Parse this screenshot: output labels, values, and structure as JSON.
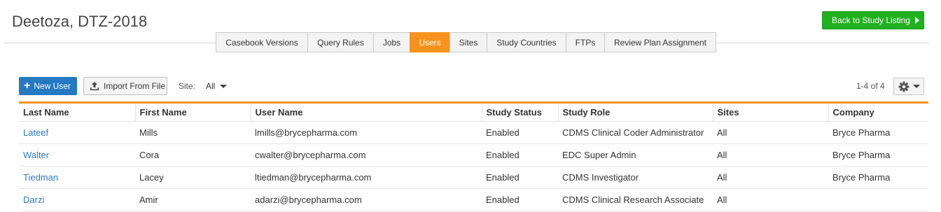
{
  "header": {
    "title": "Deetoza, DTZ-2018",
    "back_button": "Back to Study Listing"
  },
  "tabs": [
    {
      "label": "Casebook Versions",
      "active": false
    },
    {
      "label": "Query Rules",
      "active": false
    },
    {
      "label": "Jobs",
      "active": false
    },
    {
      "label": "Users",
      "active": true
    },
    {
      "label": "Sites",
      "active": false
    },
    {
      "label": "Study Countries",
      "active": false
    },
    {
      "label": "FTPs",
      "active": false
    },
    {
      "label": "Review Plan Assignment",
      "active": false
    }
  ],
  "toolbar": {
    "new_user": "New User",
    "import": "Import From File",
    "site_label": "Site:",
    "site_value": "All",
    "pager": "1-4 of 4"
  },
  "table": {
    "columns": [
      "Last Name",
      "First Name",
      "User Name",
      "Study Status",
      "Study Role",
      "Sites",
      "Company"
    ],
    "rows": [
      [
        "Lateef",
        "Mills",
        "lmills@brycepharma.com",
        "Enabled",
        "CDMS Clinical Coder Administrator",
        "All",
        "Bryce Pharma"
      ],
      [
        "Walter",
        "Cora",
        "cwalter@brycepharma.com",
        "Enabled",
        "EDC Super Admin",
        "All",
        "Bryce Pharma"
      ],
      [
        "Tiedman",
        "Lacey",
        "ltiedman@brycepharma.com",
        "Enabled",
        "CDMS Investigator",
        "All",
        "Bryce Pharma"
      ],
      [
        "Darzi",
        "Amir",
        "adarzi@brycepharma.com",
        "Enabled",
        "CDMS Clinical Research Associate",
        "All",
        ""
      ]
    ]
  },
  "colors": {
    "accent_orange": "#f7921e",
    "primary_blue": "#2479c1",
    "success_green": "#21b01f",
    "link_blue": "#2f7bbf"
  }
}
